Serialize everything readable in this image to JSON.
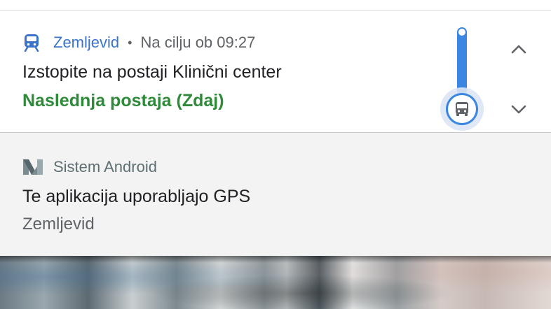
{
  "notifications": [
    {
      "app_icon": "train-icon",
      "app_name": "Zemljevid",
      "separator": "•",
      "time_text": "Na cilju ob 09:27",
      "title": "Izstopite na postaji Klinični center",
      "subtitle": "Naslednja postaja (Zdaj)",
      "progress_icon": "bus-icon",
      "progress_fraction": 1.0,
      "actions": [
        "chevron-up-icon",
        "chevron-down-icon"
      ],
      "colors": {
        "app_name": "#3a73c9",
        "subtitle": "#2e8b3a",
        "progress": "#3a86e0"
      }
    },
    {
      "app_icon": "android-n-icon",
      "app_name": "Sistem Android",
      "title": "Te aplikacija uporabljajo GPS",
      "subtitle": "Zemljevid"
    }
  ]
}
